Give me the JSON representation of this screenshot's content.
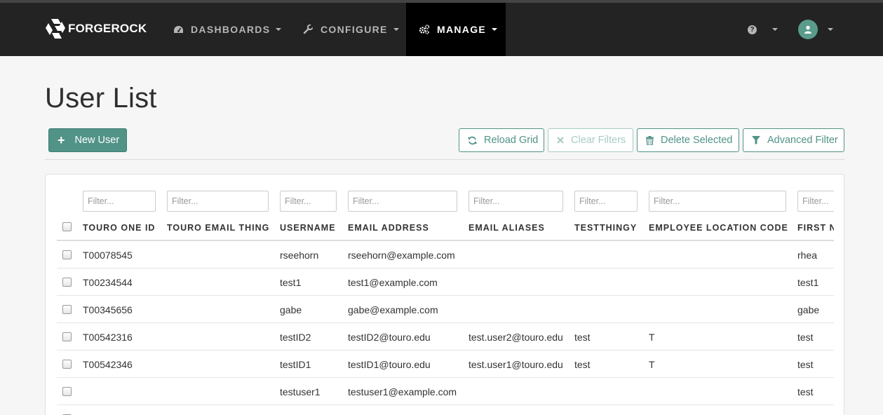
{
  "brand": {
    "name": "FORGEROCK"
  },
  "nav": {
    "dashboards": "DASHBOARDS",
    "configure": "CONFIGURE",
    "manage": "MANAGE"
  },
  "page": {
    "title": "User List"
  },
  "toolbar": {
    "new_user": "New User",
    "reload": "Reload Grid",
    "clear": "Clear Filters",
    "delete": "Delete Selected",
    "advanced": "Advanced Filter"
  },
  "filters": [
    "Filter...",
    "Filter...",
    "Filter...",
    "Filter...",
    "Filter...",
    "Filter...",
    "Filter...",
    "Filter..."
  ],
  "columns": [
    "TOURO ONE ID",
    "TOURO EMAIL THING",
    "USERNAME",
    "EMAIL ADDRESS",
    "EMAIL ALIASES",
    "TESTTHINGY",
    "EMPLOYEE LOCATION CODE",
    "FIRST N"
  ],
  "rows": [
    {
      "id": "T00078545",
      "email_thing": "",
      "username": "rseehorn",
      "email": "rseehorn@example.com",
      "aliases": "",
      "testthingy": "",
      "location": "",
      "first": "rhea"
    },
    {
      "id": "T00234544",
      "email_thing": "",
      "username": "test1",
      "email": "test1@example.com",
      "aliases": "",
      "testthingy": "",
      "location": "",
      "first": "test1"
    },
    {
      "id": "T00345656",
      "email_thing": "",
      "username": "gabe",
      "email": "gabe@example.com",
      "aliases": "",
      "testthingy": "",
      "location": "",
      "first": "gabe"
    },
    {
      "id": "T00542316",
      "email_thing": "",
      "username": "testID2",
      "email": "testID2@touro.edu",
      "aliases": "test.user2@touro.edu",
      "testthingy": "test",
      "location": "T",
      "first": "test"
    },
    {
      "id": "T00542346",
      "email_thing": "",
      "username": "testID1",
      "email": "testID1@touro.edu",
      "aliases": "test.user1@touro.edu",
      "testthingy": "test",
      "location": "T",
      "first": "test"
    },
    {
      "id": "",
      "email_thing": "",
      "username": "testuser1",
      "email": "testuser1@example.com",
      "aliases": "",
      "testthingy": "",
      "location": "",
      "first": "test"
    },
    {
      "id": "",
      "email_thing": "",
      "username": "",
      "email": "",
      "aliases": "",
      "testthingy": "",
      "location": "",
      "first": ""
    }
  ],
  "colors": {
    "accent": "#519387",
    "navbar": "#232323",
    "manage_active": "#000000"
  },
  "icons": {
    "brand": "forgerock-logo-icon",
    "dashboards": "tachometer-icon",
    "configure": "wrench-icon",
    "manage": "cogs-icon",
    "help": "question-circle-icon",
    "user": "user-avatar-icon",
    "reload": "refresh-icon",
    "clear": "times-icon",
    "delete": "trash-icon",
    "advanced": "filter-icon"
  }
}
